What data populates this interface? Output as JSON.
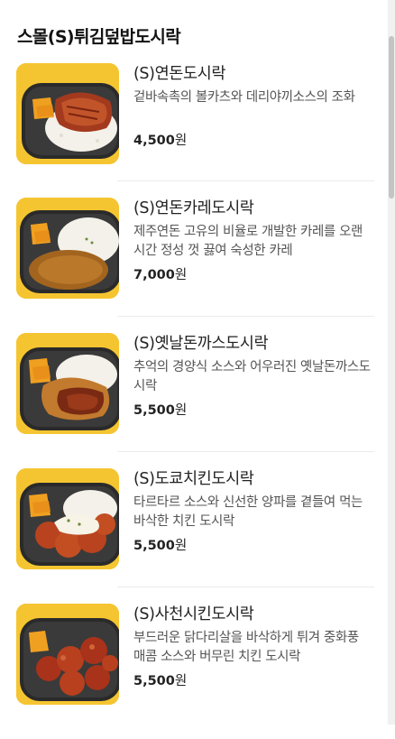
{
  "section": {
    "title": "스몰(S)튀김덮밥도시락"
  },
  "menu_items": [
    {
      "name": "(S)연돈도시락",
      "description": "겉바속촉의 볼카츠와 데리야끼소스의 조화",
      "price": "4,500",
      "currency": "원",
      "image_icon": "cutlet-lunchbox-photo"
    },
    {
      "name": "(S)연돈카레도시락",
      "description": "제주연돈 고유의 비율로 개발한 카레를 오랜시간 정성 껏 끓여 숙성한 카레",
      "price": "7,000",
      "currency": "원",
      "image_icon": "curry-lunchbox-photo"
    },
    {
      "name": "(S)옛날돈까스도시락",
      "description": "추억의 경양식 소스와 어우러진 옛날돈까스도시락",
      "price": "5,500",
      "currency": "원",
      "image_icon": "pork-cutlet-lunchbox-photo"
    },
    {
      "name": "(S)도쿄치킨도시락",
      "description": "타르타르 소스와 신선한 양파를 곁들여 먹는 바삭한 치킨 도시락",
      "price": "5,500",
      "currency": "원",
      "image_icon": "tokyo-chicken-lunchbox-photo"
    },
    {
      "name": "(S)사천시킨도시락",
      "description": "부드러운 닭다리살을 바삭하게 튀겨 중화풍 매콤 소스와 버무린 치킨 도시락",
      "price": "5,500",
      "currency": "원",
      "image_icon": "sichuan-chicken-lunchbox-photo"
    }
  ],
  "colors": {
    "thumb_background": "#f5c531",
    "divider": "#ececec",
    "text": "#222222",
    "description": "#555555"
  }
}
